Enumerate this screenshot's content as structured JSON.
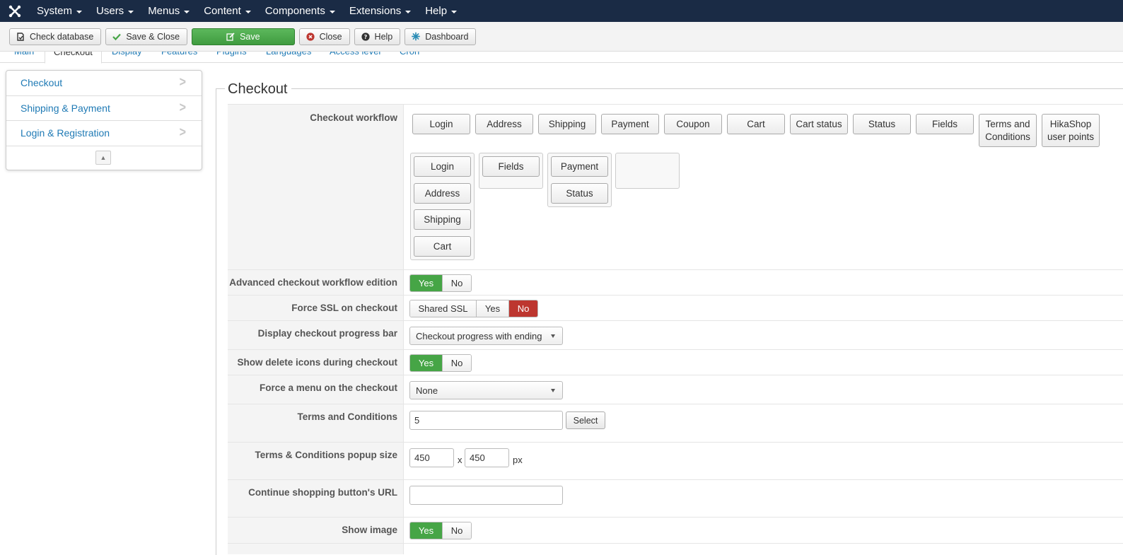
{
  "topnav": {
    "items": [
      {
        "label": "System"
      },
      {
        "label": "Users"
      },
      {
        "label": "Menus"
      },
      {
        "label": "Content"
      },
      {
        "label": "Components"
      },
      {
        "label": "Extensions"
      },
      {
        "label": "Help"
      }
    ]
  },
  "toolbar": {
    "check_database": "Check database",
    "save_close": "Save & Close",
    "save": "Save",
    "close": "Close",
    "help": "Help",
    "dashboard": "Dashboard"
  },
  "tabs": [
    "Main",
    "Checkout",
    "Display",
    "Features",
    "Plugins",
    "Languages",
    "Access level",
    "Cron"
  ],
  "sidebar": {
    "items": [
      {
        "label": "Checkout"
      },
      {
        "label": "Shipping & Payment"
      },
      {
        "label": "Login & Registration"
      }
    ]
  },
  "section": {
    "legend": "Checkout"
  },
  "fields": {
    "workflow": {
      "label": "Checkout workflow",
      "available": [
        "Login",
        "Address",
        "Shipping",
        "Payment",
        "Coupon",
        "Cart",
        "Cart status",
        "Status",
        "Fields",
        "Terms and Conditions",
        "HikaShop user points"
      ],
      "step1": [
        "Login",
        "Address",
        "Shipping",
        "Cart"
      ],
      "step2": [
        "Fields"
      ],
      "step3": [
        "Payment",
        "Status"
      ]
    },
    "advanced": {
      "label": "Advanced checkout workflow edition",
      "yes": "Yes",
      "no": "No"
    },
    "ssl": {
      "label": "Force SSL on checkout",
      "shared": "Shared SSL",
      "yes": "Yes",
      "no": "No"
    },
    "progress": {
      "label": "Display checkout progress bar",
      "value": "Checkout progress with ending"
    },
    "delete_icons": {
      "label": "Show delete icons during checkout",
      "yes": "Yes",
      "no": "No"
    },
    "force_menu": {
      "label": "Force a menu on the checkout",
      "value": "None"
    },
    "terms": {
      "label": "Terms and Conditions",
      "value": "5",
      "select": "Select"
    },
    "popup": {
      "label": "Terms & Conditions popup size",
      "width": "450",
      "height": "450",
      "x": "x",
      "unit": "px"
    },
    "continue_url": {
      "label": "Continue shopping button's URL",
      "value": ""
    },
    "show_image": {
      "label": "Show image",
      "yes": "Yes",
      "no": "No"
    }
  }
}
